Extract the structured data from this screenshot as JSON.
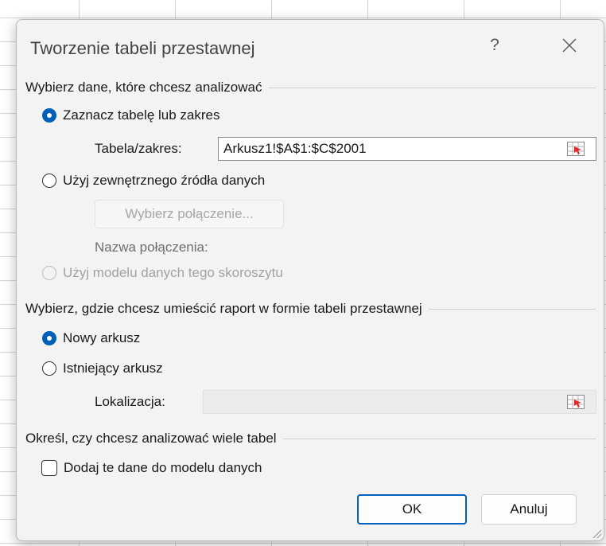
{
  "dialog": {
    "title": "Tworzenie tabeli przestawnej",
    "help_label": "?"
  },
  "data_source": {
    "heading": "Wybierz dane, które chcesz analizować",
    "select_table": {
      "label": "Zaznacz tabelę lub zakres",
      "checked": true
    },
    "table_range": {
      "label": "Tabela/zakres:",
      "value": "Arkusz1!$A$1:$C$2001"
    },
    "external_source": {
      "label": "Użyj zewnętrznego źródła danych",
      "checked": false
    },
    "choose_connection_label": "Wybierz połączenie...",
    "connection_name_label": "Nazwa połączenia:",
    "data_model": {
      "label": "Użyj modelu danych tego skoroszytu",
      "checked": false,
      "disabled": true
    }
  },
  "placement": {
    "heading": "Wybierz, gdzie chcesz umieścić raport w formie tabeli przestawnej",
    "new_sheet": {
      "label": "Nowy arkusz",
      "checked": true
    },
    "existing_sheet": {
      "label": "Istniejący arkusz",
      "checked": false
    },
    "location": {
      "label": "Lokalizacja:",
      "value": ""
    }
  },
  "multiple_tables": {
    "heading": "Określ, czy chcesz analizować wiele tabel",
    "add_to_model": {
      "label": "Dodaj te dane do modelu danych",
      "checked": false
    }
  },
  "buttons": {
    "ok": "OK",
    "cancel": "Anuluj"
  },
  "colors": {
    "accent": "#005fb8",
    "dialog_bg": "#f3f3f3",
    "disabled_text": "#a2a2a2"
  }
}
